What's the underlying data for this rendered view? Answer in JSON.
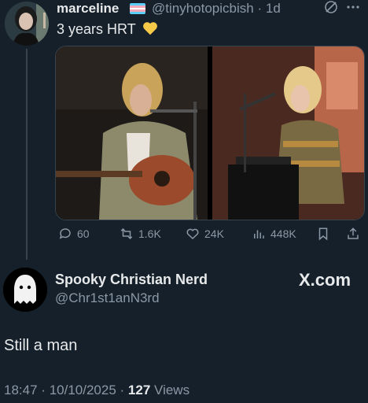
{
  "post": {
    "author_name": "marceline",
    "handle": "@tinyhotopicbish",
    "separator": "·",
    "age": "1d",
    "text": "3 years HRT",
    "emoji": "yellow-heart",
    "flag": "transgender-flag",
    "actions": {
      "replies": "60",
      "reposts": "1.6K",
      "likes": "24K",
      "views": "448K"
    }
  },
  "reply": {
    "author_name": "Spooky Christian Nerd",
    "handle": "@Chr1st1anN3rd",
    "brand": "X.com",
    "text": "Still a man",
    "time": "18:47",
    "date": "10/10/2025",
    "views_count": "127",
    "views_label": "Views"
  },
  "colors": {
    "background": "#15202b",
    "text": "#e7e9ea",
    "muted": "#8b98a5"
  }
}
